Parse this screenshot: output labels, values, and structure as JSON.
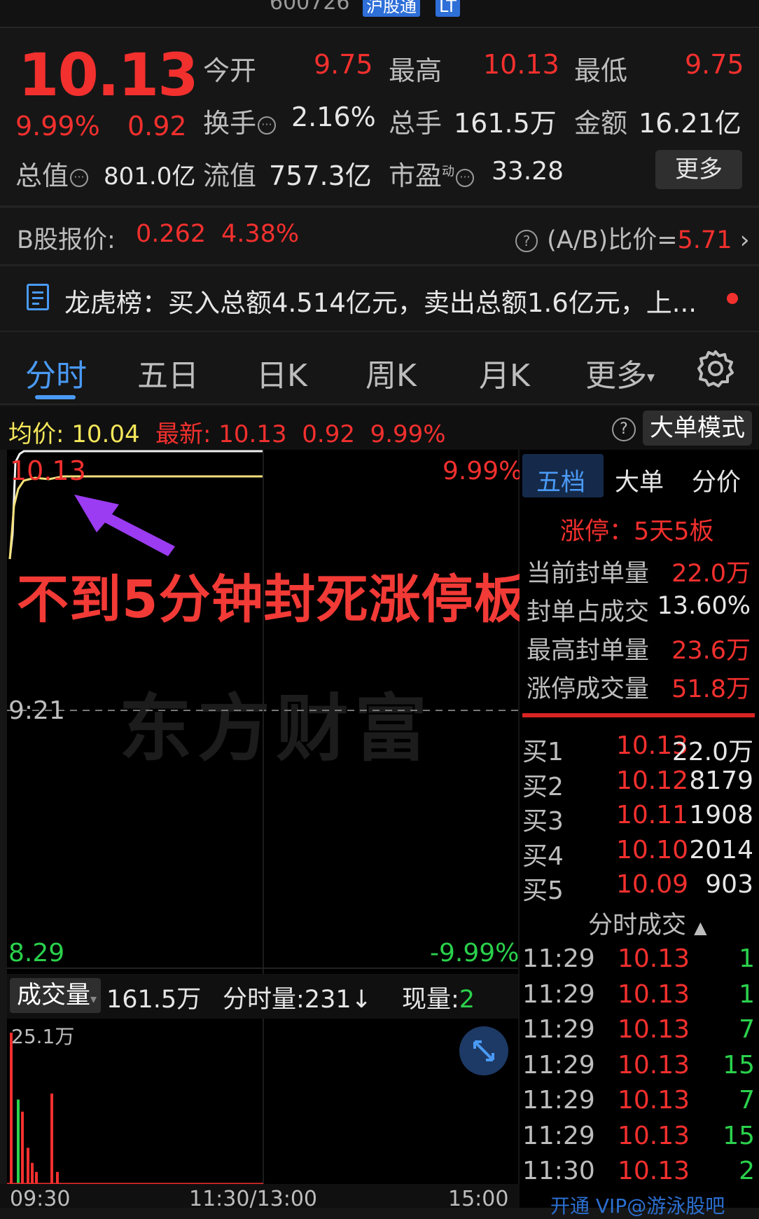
{
  "topbar": {
    "code": "600726",
    "tag1": "沪股通",
    "tag2": "LT"
  },
  "quote": {
    "price": "10.13",
    "change_pct": "9.99%",
    "change": "0.92",
    "open_label": "今开",
    "open": "9.75",
    "high_label": "最高",
    "high": "10.13",
    "low_label": "最低",
    "low": "9.75",
    "turnover_label": "换手",
    "turnover": "2.16%",
    "volume_label": "总手",
    "volume": "161.5万",
    "amount_label": "金额",
    "amount": "16.21亿",
    "mktcap_label": "总值",
    "mktcap": "801.0亿",
    "float_label": "流值",
    "float": "757.3亿",
    "pe_label": "市盈",
    "pe_sup": "动",
    "pe": "33.28",
    "more_label": "更多"
  },
  "bshare": {
    "label": "B股报价:",
    "price": "0.262",
    "pct": "4.38%",
    "ratio_label": "(A/B)比价=",
    "ratio": "5.71"
  },
  "lhb": {
    "text": "龙虎榜：买入总额4.514亿元，卖出总额1.6亿元，上..."
  },
  "tabs": [
    "分时",
    "五日",
    "日K",
    "周K",
    "月K",
    "更多"
  ],
  "avgbar": {
    "avg_label": "均价:",
    "avg": "10.04",
    "latest_label": "最新:",
    "latest": "10.13",
    "chg": "0.92",
    "pct": "9.99%",
    "mode_label": "大单模式"
  },
  "chart": {
    "top_price": "10.13",
    "top_pct": "9.99%",
    "mid_time": "9:21",
    "bottom_price": "8.29",
    "bottom_pct": "-9.99%",
    "overlay_text": "不到5分钟封死涨停板!",
    "watermark": "东方财富"
  },
  "volume": {
    "selector": "成交量",
    "total": "161.5万",
    "fs_label": "分时量:",
    "fs_value": "231↓",
    "now_label": "现量:",
    "now_value": "2",
    "max_label": "25.1万"
  },
  "bottom_axis": {
    "t1": "11:30/13:00",
    "t2": "15:00",
    "t0": "09:30"
  },
  "panel": {
    "tabs": [
      "五档",
      "大单",
      "分价"
    ],
    "limit_label": "涨停：",
    "limit_value": "5天5板",
    "stats": [
      {
        "label": "当前封单量",
        "value": "22.0万",
        "color": "red"
      },
      {
        "label": "封单占成交",
        "value": "13.60%",
        "color": "white"
      },
      {
        "label": "最高封单量",
        "value": "23.6万",
        "color": "red"
      },
      {
        "label": "涨停成交量",
        "value": "51.8万",
        "color": "red"
      }
    ],
    "bids": [
      {
        "label": "买1",
        "price": "10.13",
        "vol": "22.0万"
      },
      {
        "label": "买2",
        "price": "10.12",
        "vol": "8179"
      },
      {
        "label": "买3",
        "price": "10.11",
        "vol": "1908"
      },
      {
        "label": "买4",
        "price": "10.10",
        "vol": "2014"
      },
      {
        "label": "买5",
        "price": "10.09",
        "vol": "903"
      }
    ],
    "ticks_title": "分时成交",
    "ticks": [
      {
        "time": "11:29",
        "price": "10.13",
        "vol": "1"
      },
      {
        "time": "11:29",
        "price": "10.13",
        "vol": "1"
      },
      {
        "time": "11:29",
        "price": "10.13",
        "vol": "7"
      },
      {
        "time": "11:29",
        "price": "10.13",
        "vol": "15"
      },
      {
        "time": "11:29",
        "price": "10.13",
        "vol": "7"
      },
      {
        "time": "11:29",
        "price": "10.13",
        "vol": "15"
      },
      {
        "time": "11:30",
        "price": "10.13",
        "vol": "2"
      }
    ],
    "footer_text": "开通 VIP@游泳股吧"
  },
  "chart_data": {
    "type": "line",
    "title": "",
    "ylim": [
      8.29,
      10.13
    ],
    "series": [
      {
        "values": [
          9.75,
          10.13,
          10.13,
          10.13,
          10.13,
          10.13,
          10.13
        ]
      },
      {
        "values": [
          9.75,
          9.9,
          10.0,
          10.02,
          10.04,
          10.04,
          10.04
        ]
      }
    ],
    "volume_ylim": [
      0,
      251000
    ],
    "volume_bars": [
      {
        "value": 251000,
        "color": "red"
      },
      {
        "value": 140000,
        "color": "green"
      },
      {
        "value": 120000,
        "color": "red"
      },
      {
        "value": 60000,
        "color": "red"
      },
      {
        "value": 35000,
        "color": "red"
      },
      {
        "value": 20000,
        "color": "red"
      },
      {
        "value": 150000,
        "color": "red"
      },
      {
        "value": 20000,
        "color": "red"
      }
    ]
  }
}
